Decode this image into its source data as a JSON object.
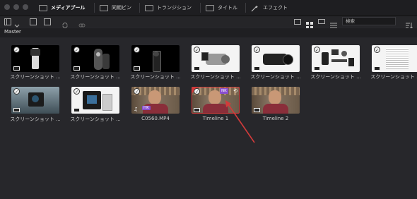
{
  "topbar": {
    "tabs": [
      {
        "label": "メディアプール",
        "icon": "media-pool-icon",
        "active": true
      },
      {
        "label": "同期ビン",
        "icon": "sync-bin-icon",
        "active": false
      },
      {
        "label": "トランジション",
        "icon": "transition-icon",
        "active": false
      },
      {
        "label": "タイトル",
        "icon": "title-icon",
        "active": false
      },
      {
        "label": "エフェクト",
        "icon": "effects-icon",
        "active": false
      }
    ]
  },
  "toolbar": {
    "search_placeholder": "検索"
  },
  "path": {
    "label": "Master"
  },
  "clips_row1": [
    {
      "name": "スクリーンショット ...",
      "kind": "image"
    },
    {
      "name": "スクリーンショット ...",
      "kind": "image"
    },
    {
      "name": "スクリーンショット ...",
      "kind": "image"
    },
    {
      "name": "スクリーンショット ...",
      "kind": "image"
    },
    {
      "name": "スクリーンショット ...",
      "kind": "image"
    },
    {
      "name": "スクリーンショット ...",
      "kind": "image"
    },
    {
      "name": "スクリーンショット ...",
      "kind": "image"
    }
  ],
  "clips_row2": [
    {
      "name": "スクリーンショット ...",
      "kind": "image"
    },
    {
      "name": "スクリーンショット ...",
      "kind": "image"
    },
    {
      "name": "C0560.MP4",
      "kind": "video",
      "tag": "HK"
    },
    {
      "name": "Timeline 1",
      "kind": "timeline",
      "tag": "NK"
    },
    {
      "name": "Timeline 2",
      "kind": "timeline"
    }
  ],
  "colors": {
    "accent_red": "#d23b3b",
    "tag_purple": "#8a4fd0"
  }
}
